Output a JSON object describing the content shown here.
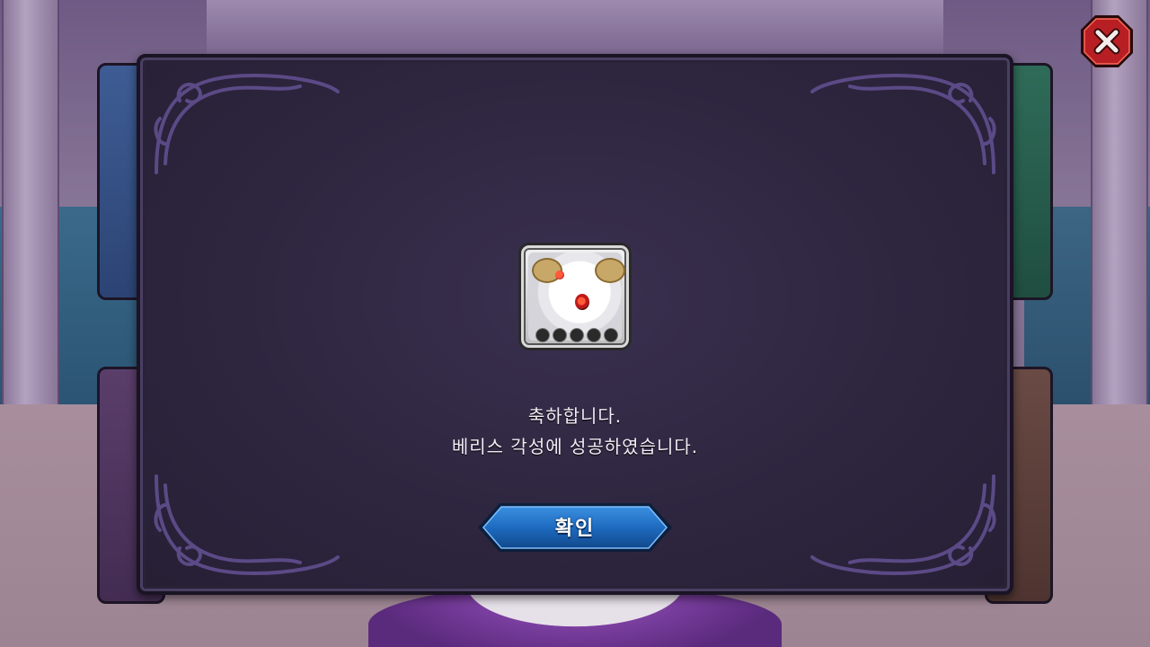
{
  "dialog": {
    "message_line1": "축하합니다.",
    "message_line2": "베리스 각성에 성공하였습니다.",
    "confirm_label": "확인"
  },
  "reward": {
    "icon": "white-ram-horned-creature-portrait",
    "star_slots": 5
  },
  "icons": {
    "close": "close-icon"
  },
  "colors": {
    "dialog_bg": "#2e263f",
    "confirm_button": "#1e6bc0",
    "close_button": "#b81f24",
    "text": "#f0ecf4"
  }
}
